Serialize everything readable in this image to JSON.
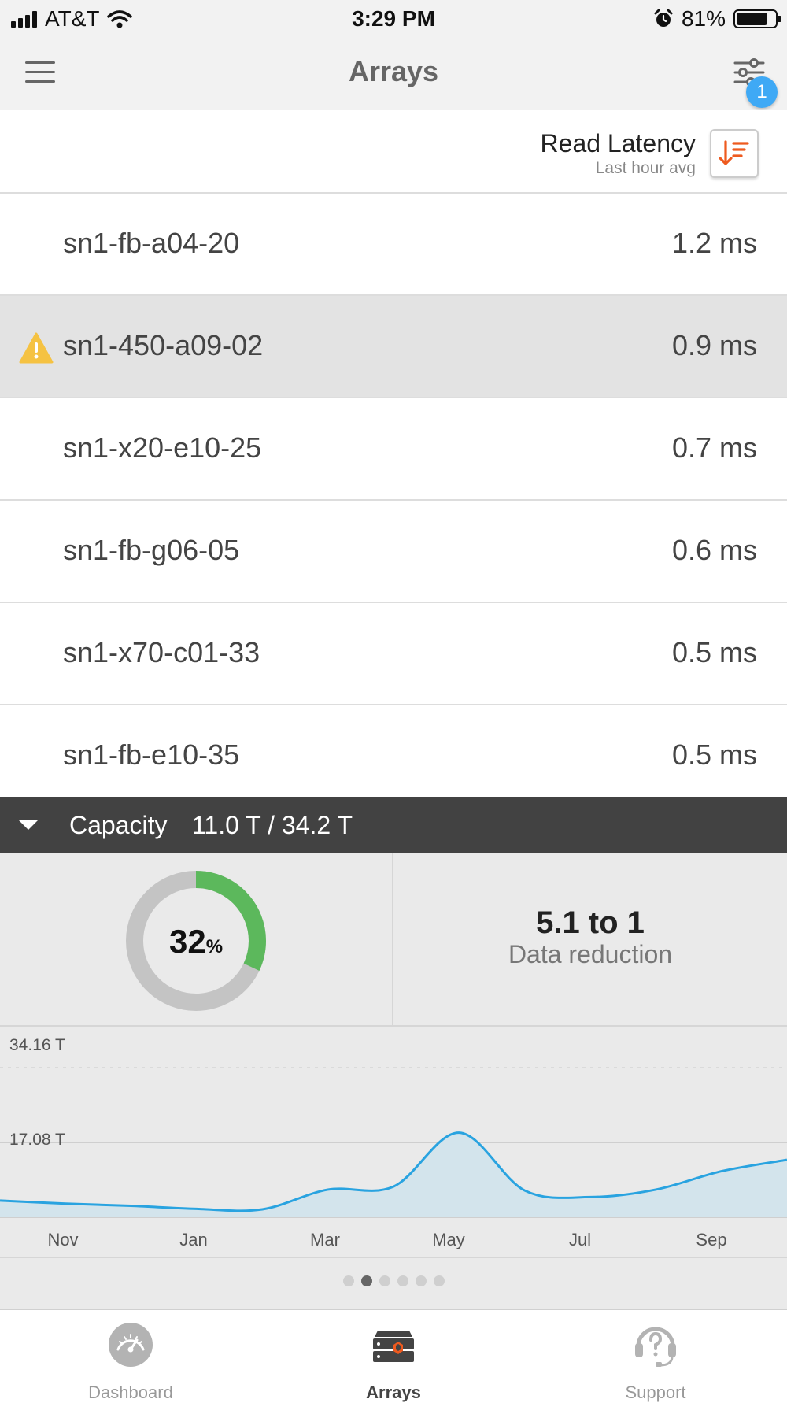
{
  "status_bar": {
    "carrier": "AT&T",
    "time": "3:29 PM",
    "battery": "81%"
  },
  "nav": {
    "title": "Arrays",
    "filter_badge": "1"
  },
  "sort": {
    "title": "Read Latency",
    "subtitle": "Last hour avg"
  },
  "arrays": [
    {
      "name": "sn1-fb-a04-20",
      "value": "1.2 ms",
      "warning": false
    },
    {
      "name": "sn1-450-a09-02",
      "value": "0.9 ms",
      "warning": true
    },
    {
      "name": "sn1-x20-e10-25",
      "value": "0.7 ms",
      "warning": false
    },
    {
      "name": "sn1-fb-g06-05",
      "value": "0.6 ms",
      "warning": false
    },
    {
      "name": "sn1-x70-c01-33",
      "value": "0.5 ms",
      "warning": false
    },
    {
      "name": "sn1-fb-e10-35",
      "value": "0.5 ms",
      "warning": false
    }
  ],
  "capacity": {
    "label": "Capacity",
    "value": "11.0 T / 34.2 T",
    "percent_value": "32",
    "percent_sign": "%",
    "ratio": "5.1 to 1",
    "ratio_label": "Data reduction",
    "colors": {
      "used": "#5cb85c",
      "free": "#c4c4c4",
      "line": "#29a3e0",
      "area": "#d3e4ec"
    }
  },
  "chart_data": {
    "type": "area",
    "yticks": [
      "34.16 T",
      "17.08 T"
    ],
    "ylim": [
      0,
      34.16
    ],
    "xticks": [
      "Nov",
      "Jan",
      "Mar",
      "May",
      "Jul",
      "Sep"
    ],
    "points": [
      {
        "x": "Oct",
        "y": 3.8
      },
      {
        "x": "Nov",
        "y": 3.1
      },
      {
        "x": "Dec",
        "y": 2.6
      },
      {
        "x": "Jan",
        "y": 1.9
      },
      {
        "x": "Feb",
        "y": 1.8
      },
      {
        "x": "Mar",
        "y": 6.3
      },
      {
        "x": "Apr",
        "y": 7.0
      },
      {
        "x": "May",
        "y": 19.3
      },
      {
        "x": "Jun",
        "y": 6.1
      },
      {
        "x": "Jul",
        "y": 4.6
      },
      {
        "x": "Aug",
        "y": 6.3
      },
      {
        "x": "Sep",
        "y": 10.5
      },
      {
        "x": "Oct",
        "y": 13.1
      }
    ]
  },
  "pager": {
    "count": 6,
    "active": 1
  },
  "tabs": [
    {
      "label": "Dashboard",
      "active": false
    },
    {
      "label": "Arrays",
      "active": true
    },
    {
      "label": "Support",
      "active": false
    }
  ]
}
